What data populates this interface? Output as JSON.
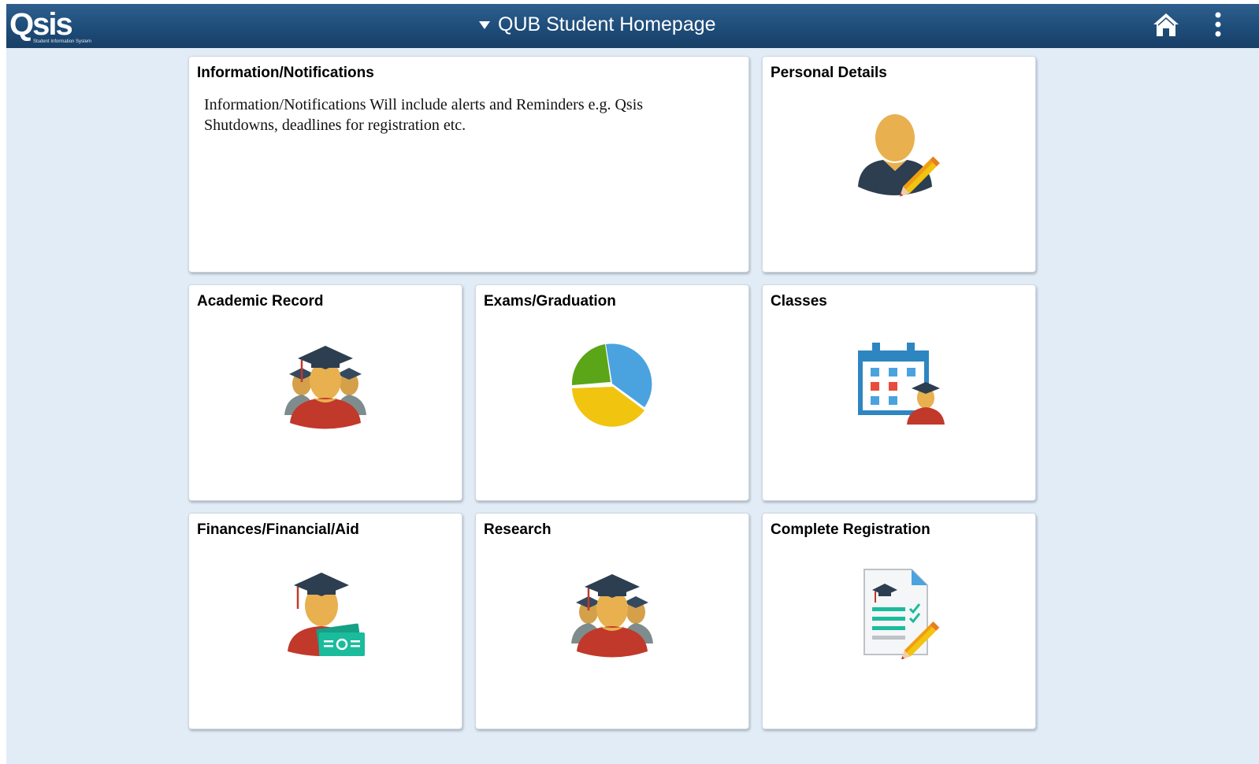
{
  "banner": {
    "logo_text": "Qsis",
    "logo_tagline": "Student Information System",
    "title": "QUB Student Homepage",
    "home_icon": "home-icon",
    "menu_icon": "kebab-menu-icon"
  },
  "colors": {
    "banner": "#1d4b77",
    "page_background": "#e1ecf7",
    "tile_background": "#ffffff",
    "icon_skin": "#e8b04e",
    "icon_gown": "#c0392b",
    "icon_cap": "#2c3e50",
    "icon_blue": "#3a8fd6",
    "icon_green": "#1abc9c"
  },
  "tiles": {
    "info": {
      "title": "Information/Notifications",
      "body": "Information/Notifications Will include alerts and Reminders e.g. Qsis Shutdowns, deadlines for registration etc."
    },
    "personal": {
      "title": "Personal Details",
      "icon": "user-edit-icon"
    },
    "academic": {
      "title": "Academic Record",
      "icon": "graduates-group-icon"
    },
    "exams": {
      "title": "Exams/Graduation",
      "icon": "pie-chart-icon"
    },
    "classes": {
      "title": "Classes",
      "icon": "calendar-student-icon"
    },
    "finances": {
      "title": "Finances/Financial/Aid",
      "icon": "graduate-money-icon"
    },
    "research": {
      "title": "Research",
      "icon": "graduates-group-icon"
    },
    "registration": {
      "title": "Complete Registration",
      "icon": "checklist-document-icon"
    }
  }
}
